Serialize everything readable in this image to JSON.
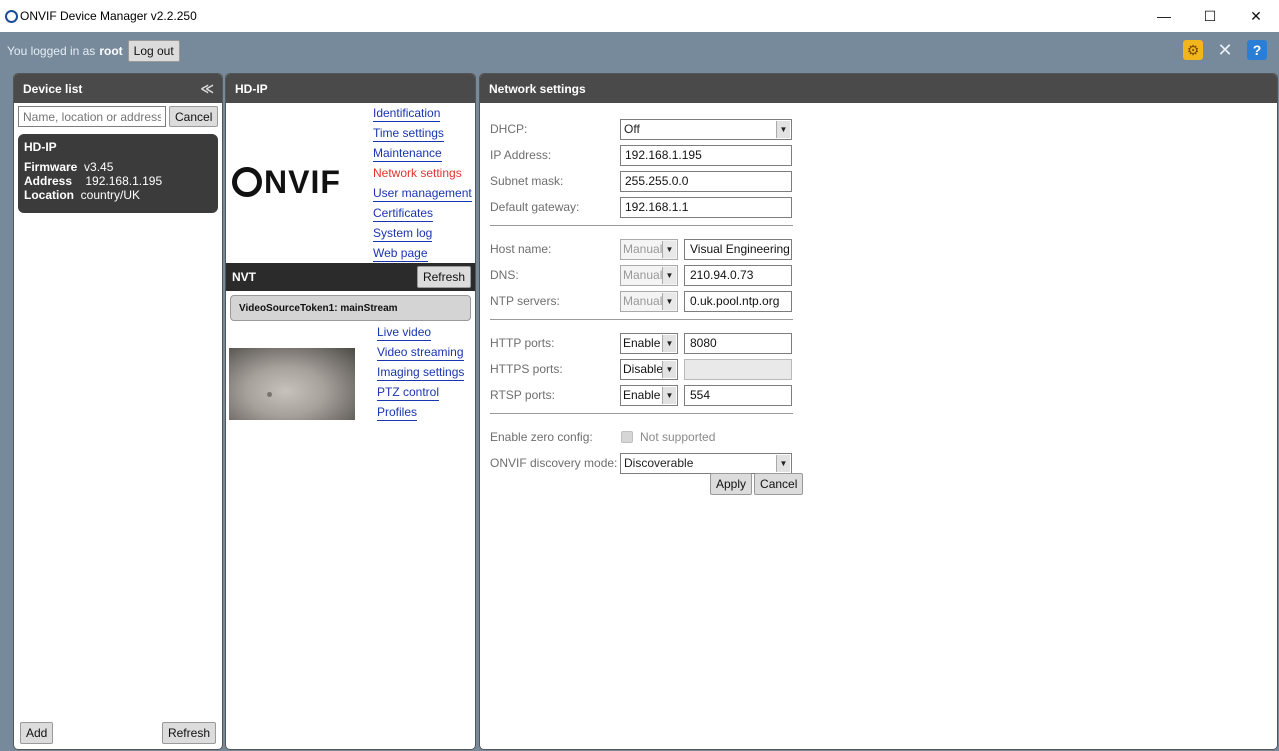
{
  "window": {
    "title": "ONVIF Device Manager v2.2.250",
    "minimize": "—",
    "maximize": "☐",
    "close": "✕"
  },
  "login": {
    "prefix": "You logged in as",
    "user": "root",
    "logout_label": "Log out",
    "icons": [
      "gear-settings-icon",
      "tools-icon",
      "help-icon"
    ]
  },
  "device_list": {
    "title": "Device list",
    "collapse_glyph": "≪",
    "search_placeholder": "Name, location or address",
    "cancel_label": "Cancel",
    "devices": [
      {
        "name": "HD-IP",
        "firmware_label": "Firmware",
        "firmware": "v3.45",
        "address_label": "Address",
        "address": "192.168.1.195",
        "location_label": "Location",
        "location": "country/UK"
      }
    ],
    "add_label": "Add",
    "refresh_label": "Refresh"
  },
  "device": {
    "title": "HD-IP",
    "logo_text": "NVIF",
    "menu": [
      {
        "label": "Identification",
        "active": false
      },
      {
        "label": "Time settings",
        "active": false
      },
      {
        "label": "Maintenance",
        "active": false
      },
      {
        "label": "Network settings",
        "active": true
      },
      {
        "label": "User management",
        "active": false
      },
      {
        "label": "Certificates",
        "active": false
      },
      {
        "label": "System log",
        "active": false
      },
      {
        "label": "Web page",
        "active": false
      }
    ],
    "nvt": {
      "title": "NVT",
      "refresh_label": "Refresh",
      "stream": "VideoSourceToken1: mainStream",
      "links": [
        "Live video",
        "Video streaming",
        "Imaging settings",
        "PTZ control",
        "Profiles"
      ]
    }
  },
  "network": {
    "title": "Network settings",
    "dhcp_label": "DHCP:",
    "dhcp_value": "Off",
    "ip_label": "IP Address:",
    "ip_value": "192.168.1.195",
    "subnet_label": "Subnet mask:",
    "subnet_value": "255.255.0.0",
    "gateway_label": "Default gateway:",
    "gateway_value": "192.168.1.1",
    "host_label": "Host name:",
    "host_mode": "Manual",
    "host_value": "Visual Engineering",
    "dns_label": "DNS:",
    "dns_mode": "Manual",
    "dns_value": "210.94.0.73",
    "ntp_label": "NTP servers:",
    "ntp_mode": "Manual",
    "ntp_value": "0.uk.pool.ntp.org",
    "http_label": "HTTP ports:",
    "http_mode": "Enable",
    "http_value": "8080",
    "https_label": "HTTPS ports:",
    "https_mode": "Disable",
    "https_value": "",
    "rtsp_label": "RTSP ports:",
    "rtsp_mode": "Enable",
    "rtsp_value": "554",
    "zeroconf_label": "Enable zero config:",
    "zeroconf_value": "Not supported",
    "discovery_label": "ONVIF discovery mode:",
    "discovery_value": "Discoverable",
    "apply_label": "Apply",
    "cancel_label": "Cancel"
  }
}
